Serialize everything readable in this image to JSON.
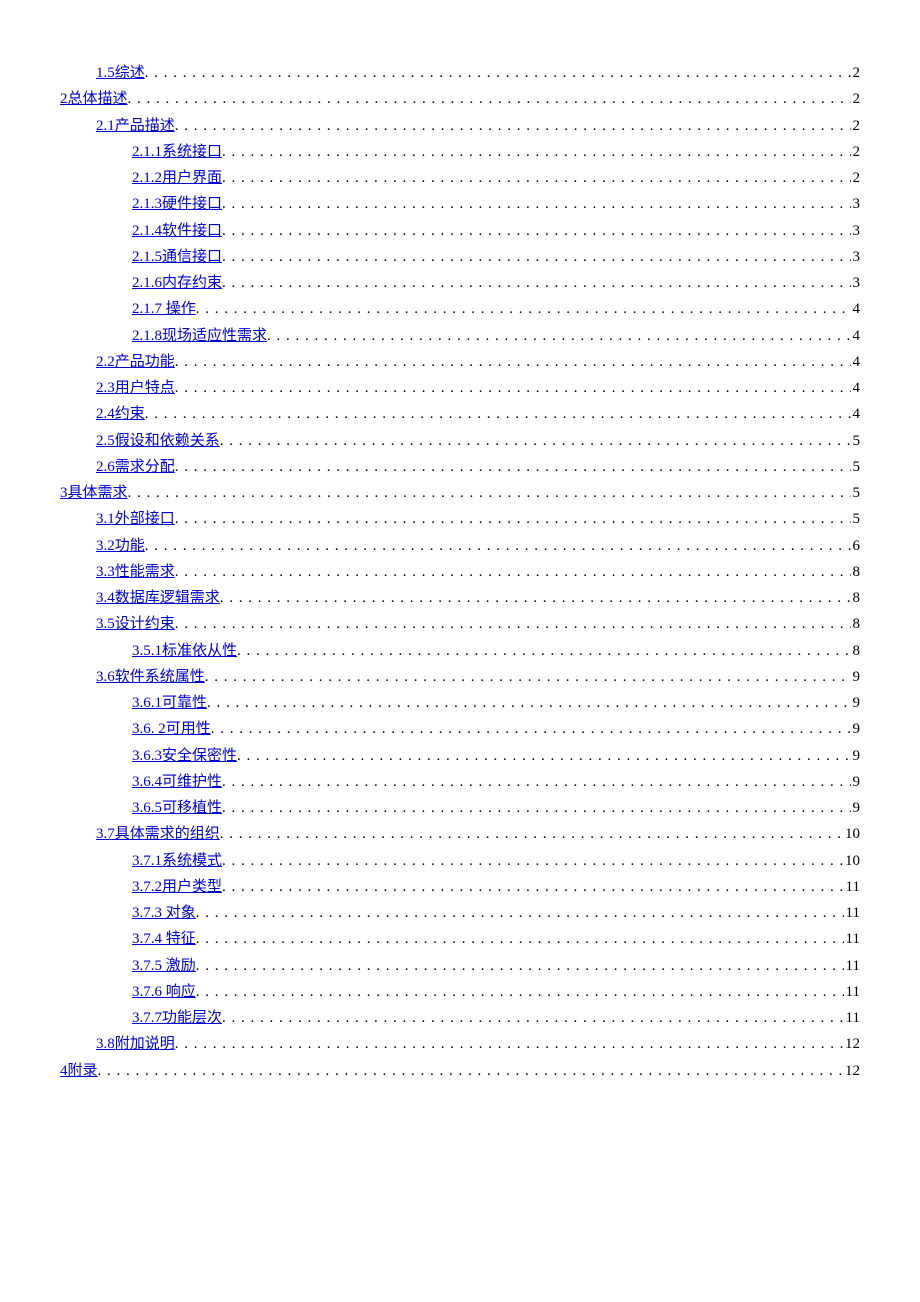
{
  "toc": [
    {
      "level": 1,
      "label": "1.5综述",
      "page": "2"
    },
    {
      "level": 0,
      "label": "2总体描述",
      "page": "2"
    },
    {
      "level": 1,
      "label": "2.1产品描述",
      "page": "2"
    },
    {
      "level": 2,
      "label": "2.1.1系统接口",
      "page": "2"
    },
    {
      "level": 2,
      "label": "2.1.2用户界面",
      "page": "2"
    },
    {
      "level": 2,
      "label": "2.1.3硬件接口",
      "page": "3"
    },
    {
      "level": 2,
      "label": "2.1.4软件接口",
      "page": "3"
    },
    {
      "level": 2,
      "label": "2.1.5通信接口",
      "page": "3"
    },
    {
      "level": 2,
      "label": "2.1.6内存约束",
      "page": "3"
    },
    {
      "level": 2,
      "label": "2.1.7 操作",
      "page": "4"
    },
    {
      "level": 2,
      "label": "2.1.8现场适应性需求",
      "page": "4"
    },
    {
      "level": 1,
      "label": "2.2产品功能",
      "page": "4"
    },
    {
      "level": 1,
      "label": "2.3用户特点",
      "page": "4"
    },
    {
      "level": 1,
      "label": "2.4约束",
      "page": "4"
    },
    {
      "level": 1,
      "label": "2.5假设和依赖关系",
      "page": "5"
    },
    {
      "level": 1,
      "label": "2.6需求分配",
      "page": "5"
    },
    {
      "level": 0,
      "label": "3具体需求",
      "page": "5"
    },
    {
      "level": 1,
      "label": "3.1外部接口",
      "page": "5"
    },
    {
      "level": 1,
      "label": "3.2功能",
      "page": "6"
    },
    {
      "level": 1,
      "label": "3.3性能需求",
      "page": "8"
    },
    {
      "level": 1,
      "label": "3.4数据库逻辑需求",
      "page": "8"
    },
    {
      "level": 1,
      "label": "3.5设计约束",
      "page": "8"
    },
    {
      "level": 2,
      "label": "3.5.1标准依从性",
      "page": "8"
    },
    {
      "level": 1,
      "label": "3.6软件系统属性",
      "page": "9"
    },
    {
      "level": 2,
      "label": "3.6.1可靠性",
      "page": "9"
    },
    {
      "level": 2,
      "label": "3.6. 2可用性",
      "page": "9"
    },
    {
      "level": 2,
      "label": "3.6.3安全保密性",
      "page": "9"
    },
    {
      "level": 2,
      "label": "3.6.4可维护性",
      "page": "9"
    },
    {
      "level": 2,
      "label": "3.6.5可移植性",
      "page": "9"
    },
    {
      "level": 1,
      "label": "3.7具体需求的组织",
      "page": "10"
    },
    {
      "level": 2,
      "label": "3.7.1系统模式",
      "page": "10"
    },
    {
      "level": 2,
      "label": "3.7.2用户类型",
      "page": "11"
    },
    {
      "level": 2,
      "label": "3.7.3 对象",
      "page": "11"
    },
    {
      "level": 2,
      "label": "3.7.4 特征",
      "page": "11"
    },
    {
      "level": 2,
      "label": "3.7.5 激励",
      "page": "11"
    },
    {
      "level": 2,
      "label": "3.7.6 响应",
      "page": "11"
    },
    {
      "level": 2,
      "label": "3.7.7功能层次",
      "page": "11"
    },
    {
      "level": 1,
      "label": "3.8附加说明",
      "page": "12"
    },
    {
      "level": 0,
      "label": "4附录",
      "page": "12"
    }
  ]
}
